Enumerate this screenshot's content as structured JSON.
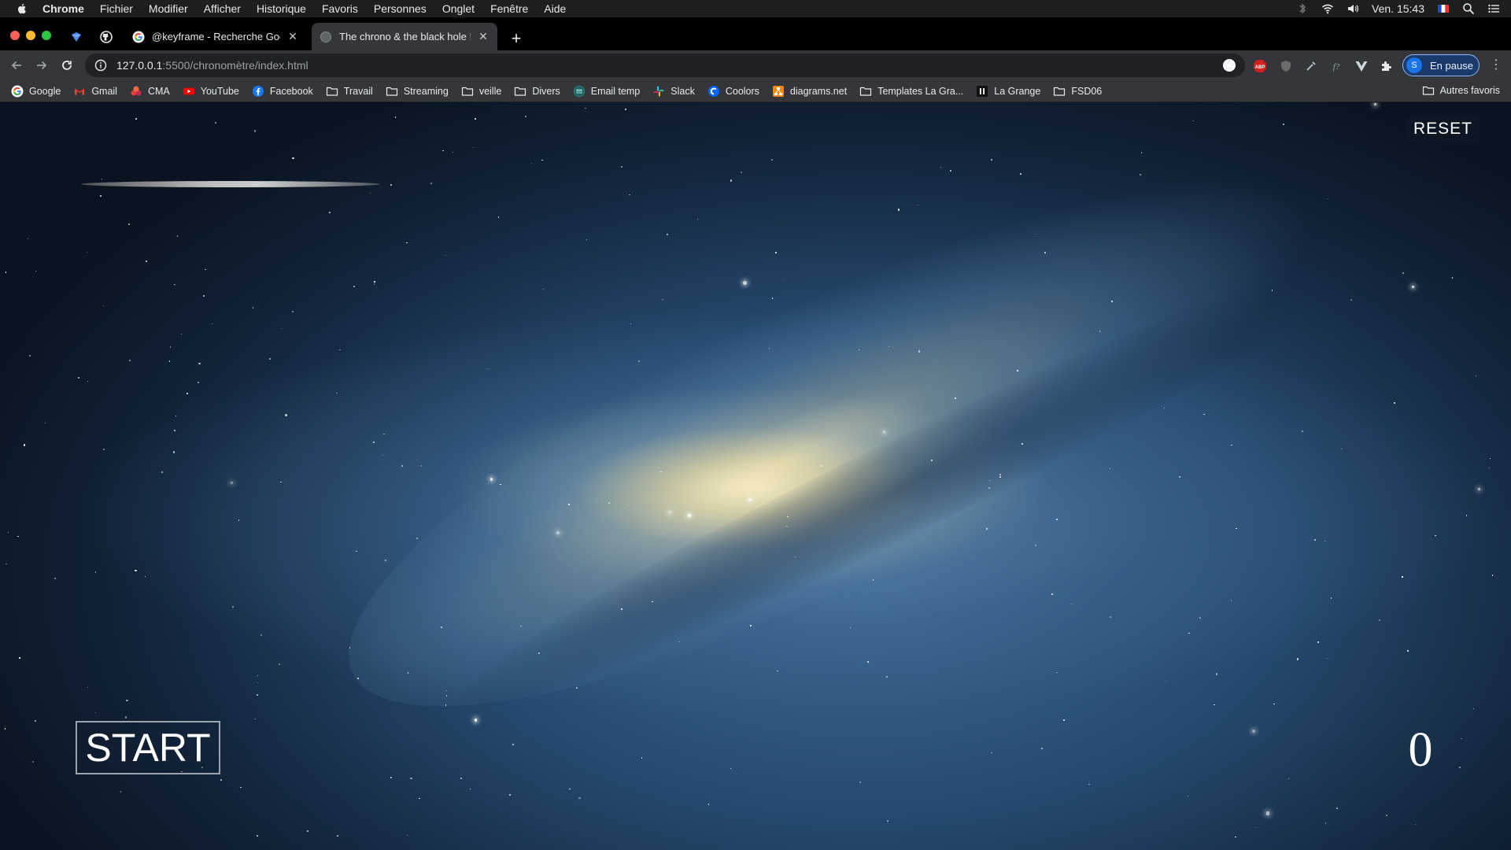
{
  "menubar": {
    "app_name": "Chrome",
    "items": [
      "Fichier",
      "Modifier",
      "Afficher",
      "Historique",
      "Favoris",
      "Personnes",
      "Onglet",
      "Fenêtre",
      "Aide"
    ],
    "clock": "Ven. 15:43"
  },
  "tabs": [
    {
      "title": "@keyframe - Recherche Googl",
      "active": false
    },
    {
      "title": "The chrono & the black hole !",
      "active": true
    }
  ],
  "toolbar": {
    "url_host": "127.0.0.1",
    "url_path": ":5500/chronomètre/index.html",
    "profile_initial": "S",
    "profile_status": "En pause",
    "abp_label": "ABP",
    "formula_label": "f?"
  },
  "bookmarks": {
    "items": [
      {
        "label": "Google",
        "icon": "google-icon"
      },
      {
        "label": "Gmail",
        "icon": "gmail-icon"
      },
      {
        "label": "CMA",
        "icon": "cma-icon"
      },
      {
        "label": "YouTube",
        "icon": "youtube-icon"
      },
      {
        "label": "Facebook",
        "icon": "facebook-icon"
      },
      {
        "label": "Travail",
        "icon": "folder-icon"
      },
      {
        "label": "Streaming",
        "icon": "folder-icon"
      },
      {
        "label": "veille",
        "icon": "folder-icon"
      },
      {
        "label": "Divers",
        "icon": "folder-icon"
      },
      {
        "label": "Email temp",
        "icon": "email-temp-icon"
      },
      {
        "label": "Slack",
        "icon": "slack-icon"
      },
      {
        "label": "Coolors",
        "icon": "coolors-icon"
      },
      {
        "label": "diagrams.net",
        "icon": "diagrams-icon"
      },
      {
        "label": "Templates La Gra...",
        "icon": "folder-icon"
      },
      {
        "label": "La Grange",
        "icon": "la-grange-icon"
      },
      {
        "label": "FSD06",
        "icon": "folder-icon"
      }
    ],
    "other": "Autres favoris"
  },
  "page": {
    "reset_label": "RESET",
    "start_label": "START",
    "counter_value": "0"
  }
}
